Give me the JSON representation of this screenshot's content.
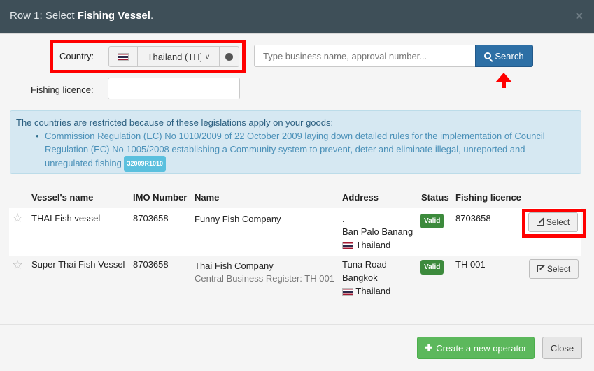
{
  "header": {
    "title_prefix": "Row 1: Select ",
    "title_bold": "Fishing Vessel",
    "title_suffix": ".",
    "close_symbol": "×"
  },
  "form": {
    "country_label": "Country:",
    "country_value": "Thailand (TH)",
    "search_placeholder": "Type business name, approval number...",
    "search_button": "Search",
    "licence_label": "Fishing licence:",
    "licence_value": ""
  },
  "alert": {
    "title": "The countries are restricted because of these legislations apply on your goods:",
    "item_text": "Commission Regulation (EC) No 1010/2009 of 22 October 2009 laying down detailed rules for the implementation of Council Regulation (EC) No 1005/2008 establishing a Community system to prevent, deter and eliminate illegal, unreported and unregulated fishing",
    "item_badge": "32009R1010"
  },
  "table": {
    "headers": [
      "Vessel's name",
      "IMO Number",
      "Name",
      "Address",
      "Status",
      "Fishing licence"
    ],
    "rows": [
      {
        "vessel": "THAI Fish vessel",
        "imo": "8703658",
        "name": "Funny Fish Company",
        "sub": "",
        "address_line1": ".",
        "address_line2": "Ban Palo Banang",
        "country": "Thailand",
        "status": "Valid",
        "licence": "8703658",
        "button": "Select"
      },
      {
        "vessel": "Super Thai Fish Vessel",
        "imo": "8703658",
        "name": "Thai Fish Company",
        "sub": "Central Business Register: TH 001",
        "address_line1": "Tuna Road",
        "address_line2": "Bangkok",
        "country": "Thailand",
        "status": "Valid",
        "licence": "TH 001",
        "button": "Select"
      }
    ]
  },
  "footer": {
    "create_label": "Create a new operator",
    "close_label": "Close"
  },
  "colors": {
    "header_bg": "#3e4f58",
    "highlight": "#ff0000",
    "primary": "#2d6fa5",
    "success": "#5cb85c",
    "valid_badge": "#3c8a3c"
  }
}
